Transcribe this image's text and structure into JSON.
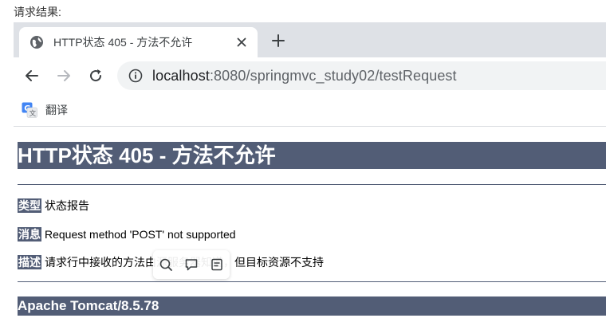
{
  "caption": "请求结果:",
  "browser": {
    "tab": {
      "title": "HTTP状态 405 - 方法不允许",
      "favicon": "globe-icon"
    },
    "omnibox": {
      "host": "localhost",
      "rest": ":8080/springmvc_study02/testRequest"
    },
    "bookmark": {
      "label": "翻译",
      "icon": "google-translate-icon"
    }
  },
  "page": {
    "title": "HTTP状态 405 - 方法不允许",
    "rows": [
      {
        "label": "类型",
        "value": "状态报告"
      },
      {
        "label": "消息",
        "value": "Request method 'POST' not supported"
      },
      {
        "label": "描述",
        "value": "请求行中接收的方法由源服务器知道，但目标资源不支持"
      }
    ],
    "footer": "Apache Tomcat/8.5.78"
  },
  "colors": {
    "tomcat_bar": "#525d76",
    "tabstrip": "#dee1e6",
    "omnibox": "#f1f3f4"
  }
}
